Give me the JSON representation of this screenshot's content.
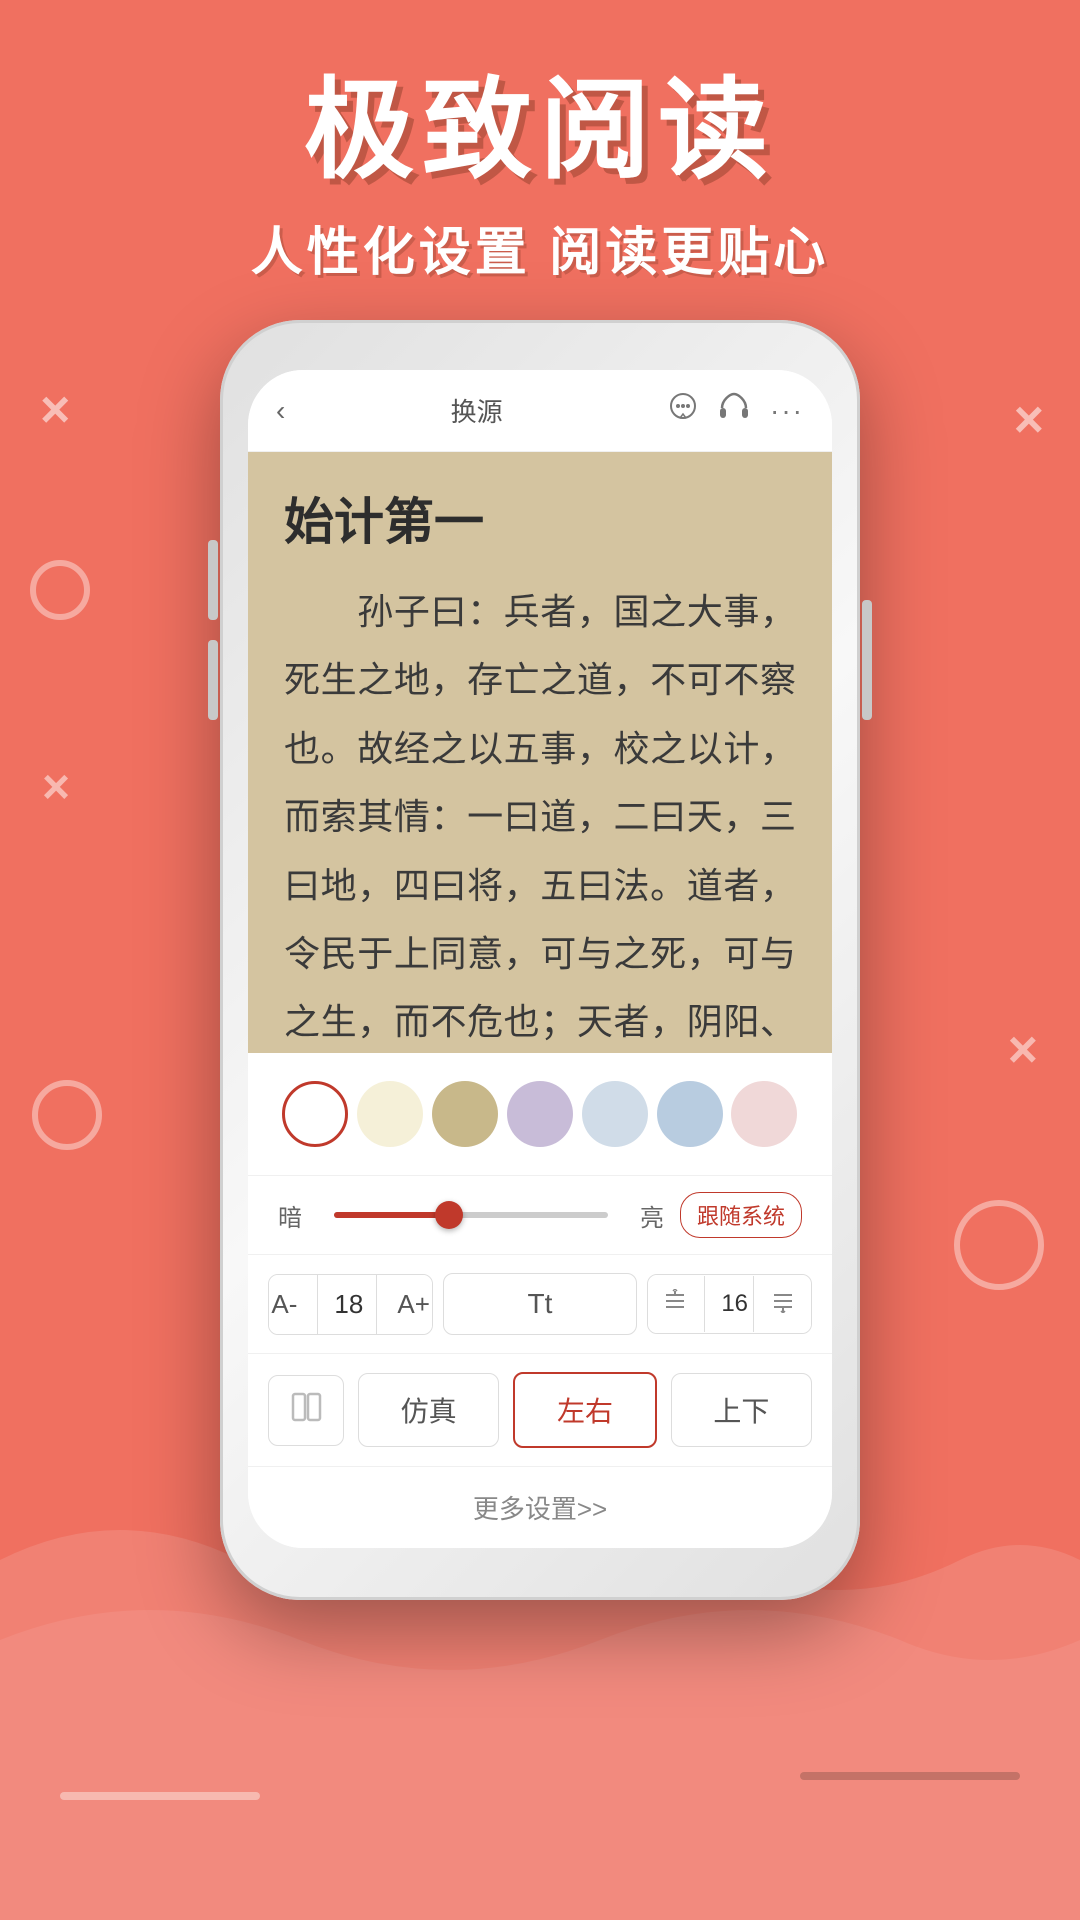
{
  "header": {
    "main_title": "极致阅读",
    "sub_title": "人性化设置  阅读更贴心"
  },
  "phone": {
    "topbar": {
      "back_label": "‹",
      "title": "换源",
      "chat_icon": "💬",
      "headphone_icon": "🎧",
      "more_icon": "···"
    },
    "reading": {
      "chapter_title": "始计第一",
      "text": "　　孙子曰：兵者，国之大事，死生之地，存亡之道，不可不察也。故经之以五事，校之以计，而索其情：一曰道，二曰天，三曰地，四曰将，五曰法。道者，令民于上同意，可与之死，可与之生，而不危也；天者，阴阳、寒暑、时制也；地者，远近、险易、广狭、死生也；将者，智、"
    },
    "settings": {
      "colors": [
        {
          "id": "white",
          "hex": "#ffffff",
          "selected": true
        },
        {
          "id": "cream",
          "hex": "#f5f0d8",
          "selected": false
        },
        {
          "id": "tan",
          "hex": "#c8b88a",
          "selected": false
        },
        {
          "id": "lavender",
          "hex": "#c8bcd8",
          "selected": false
        },
        {
          "id": "lightblue",
          "hex": "#d0dce8",
          "selected": false
        },
        {
          "id": "skyblue",
          "hex": "#b8cce0",
          "selected": false
        },
        {
          "id": "pink",
          "hex": "#f0d8d8",
          "selected": false
        }
      ],
      "brightness": {
        "dark_label": "暗",
        "light_label": "亮",
        "follow_system": "跟随系统",
        "value": 42
      },
      "font": {
        "decrease_label": "A-",
        "size_label": "18",
        "increase_label": "A+",
        "type_label": "Tt",
        "line_height_label": "16"
      },
      "layout": {
        "scroll_label": "仿真",
        "horizontal_label": "左右",
        "vertical_label": "上下"
      },
      "more_settings_label": "更多设置>>"
    }
  }
}
